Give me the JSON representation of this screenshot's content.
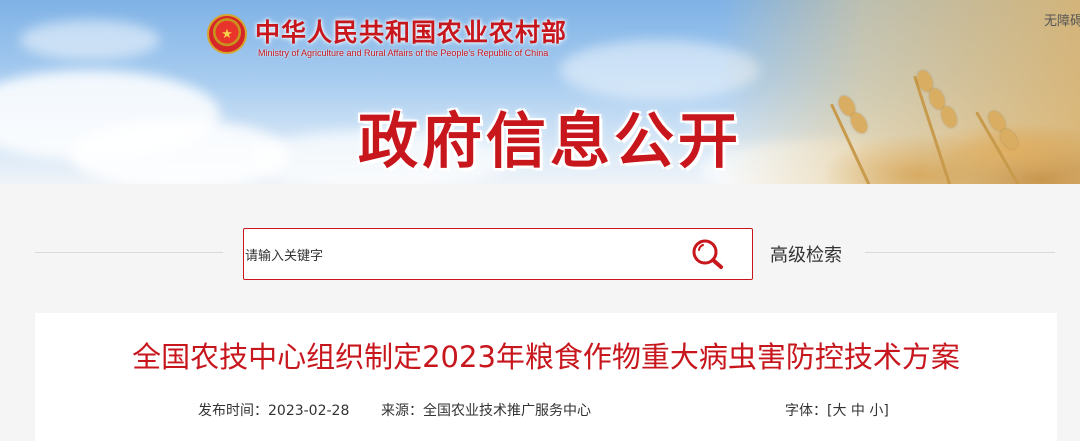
{
  "header": {
    "ministry_name_cn": "中华人民共和国农业农村部",
    "ministry_name_en": "Ministry of Agriculture and Rural Affairs of the People's Republic of China",
    "section_title": "政府信息公开",
    "accessibility_label": "无障碍",
    "emblem_icon": "national-emblem-icon"
  },
  "search": {
    "placeholder": "请输入关键字",
    "button_icon": "search-icon",
    "advanced_label": "高级检索"
  },
  "article": {
    "title": "全国农技中心组织制定2023年粮食作物重大病虫害防控技术方案",
    "published_label": "发布时间：",
    "published_date": "2023-02-28",
    "source_label": "来源：",
    "source_value": "全国农业技术推广服务中心",
    "font_label": "字体：",
    "font_open_bracket": "[",
    "font_large": "大",
    "font_medium": "中",
    "font_small": "小",
    "font_close_bracket": "]"
  },
  "colors": {
    "brand_red": "#c8161d",
    "page_bg": "#f5f5f5"
  }
}
